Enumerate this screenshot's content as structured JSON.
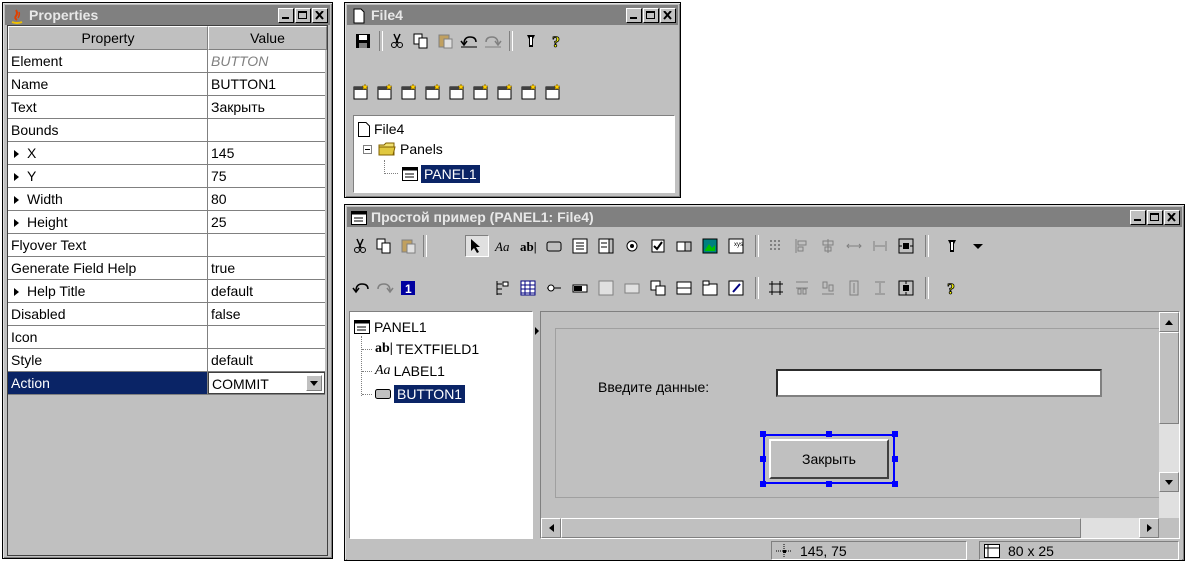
{
  "properties_window": {
    "title": "Properties",
    "col_property": "Property",
    "col_value": "Value",
    "rows": [
      {
        "name": "Element",
        "value": "BUTTON"
      },
      {
        "name": "Name",
        "value": "BUTTON1"
      },
      {
        "name": "Text",
        "value": "Закрыть"
      },
      {
        "name": "Bounds",
        "value": ""
      },
      {
        "name": "X",
        "value": "145"
      },
      {
        "name": "Y",
        "value": "75"
      },
      {
        "name": "Width",
        "value": "80"
      },
      {
        "name": "Height",
        "value": "25"
      },
      {
        "name": "Flyover Text",
        "value": ""
      },
      {
        "name": "Generate Field Help",
        "value": "true"
      },
      {
        "name": "Help Title",
        "value": "default"
      },
      {
        "name": "Disabled",
        "value": "false"
      },
      {
        "name": "Icon",
        "value": ""
      },
      {
        "name": "Style",
        "value": "default"
      },
      {
        "name": "Action",
        "value": "COMMIT"
      }
    ]
  },
  "file_window": {
    "title": "File4",
    "tree": {
      "root": "File4",
      "folder": "Panels",
      "panel": "PANEL1"
    }
  },
  "panel_window": {
    "title": "Простой пример (PANEL1: File4)",
    "tree": {
      "root": "PANEL1",
      "items": [
        "TEXTFIELD1",
        "LABEL1",
        "BUTTON1"
      ]
    },
    "canvas": {
      "label_text": "Введите данные:",
      "textfield_value": "",
      "button_label": "Закрыть"
    },
    "status": {
      "position": "145, 75",
      "size": "80 x 25"
    }
  },
  "colors": {
    "selection": "#0a2466",
    "title_inactive": "#808080",
    "window_face": "#c0c0c0",
    "grip": "#0000ff"
  }
}
